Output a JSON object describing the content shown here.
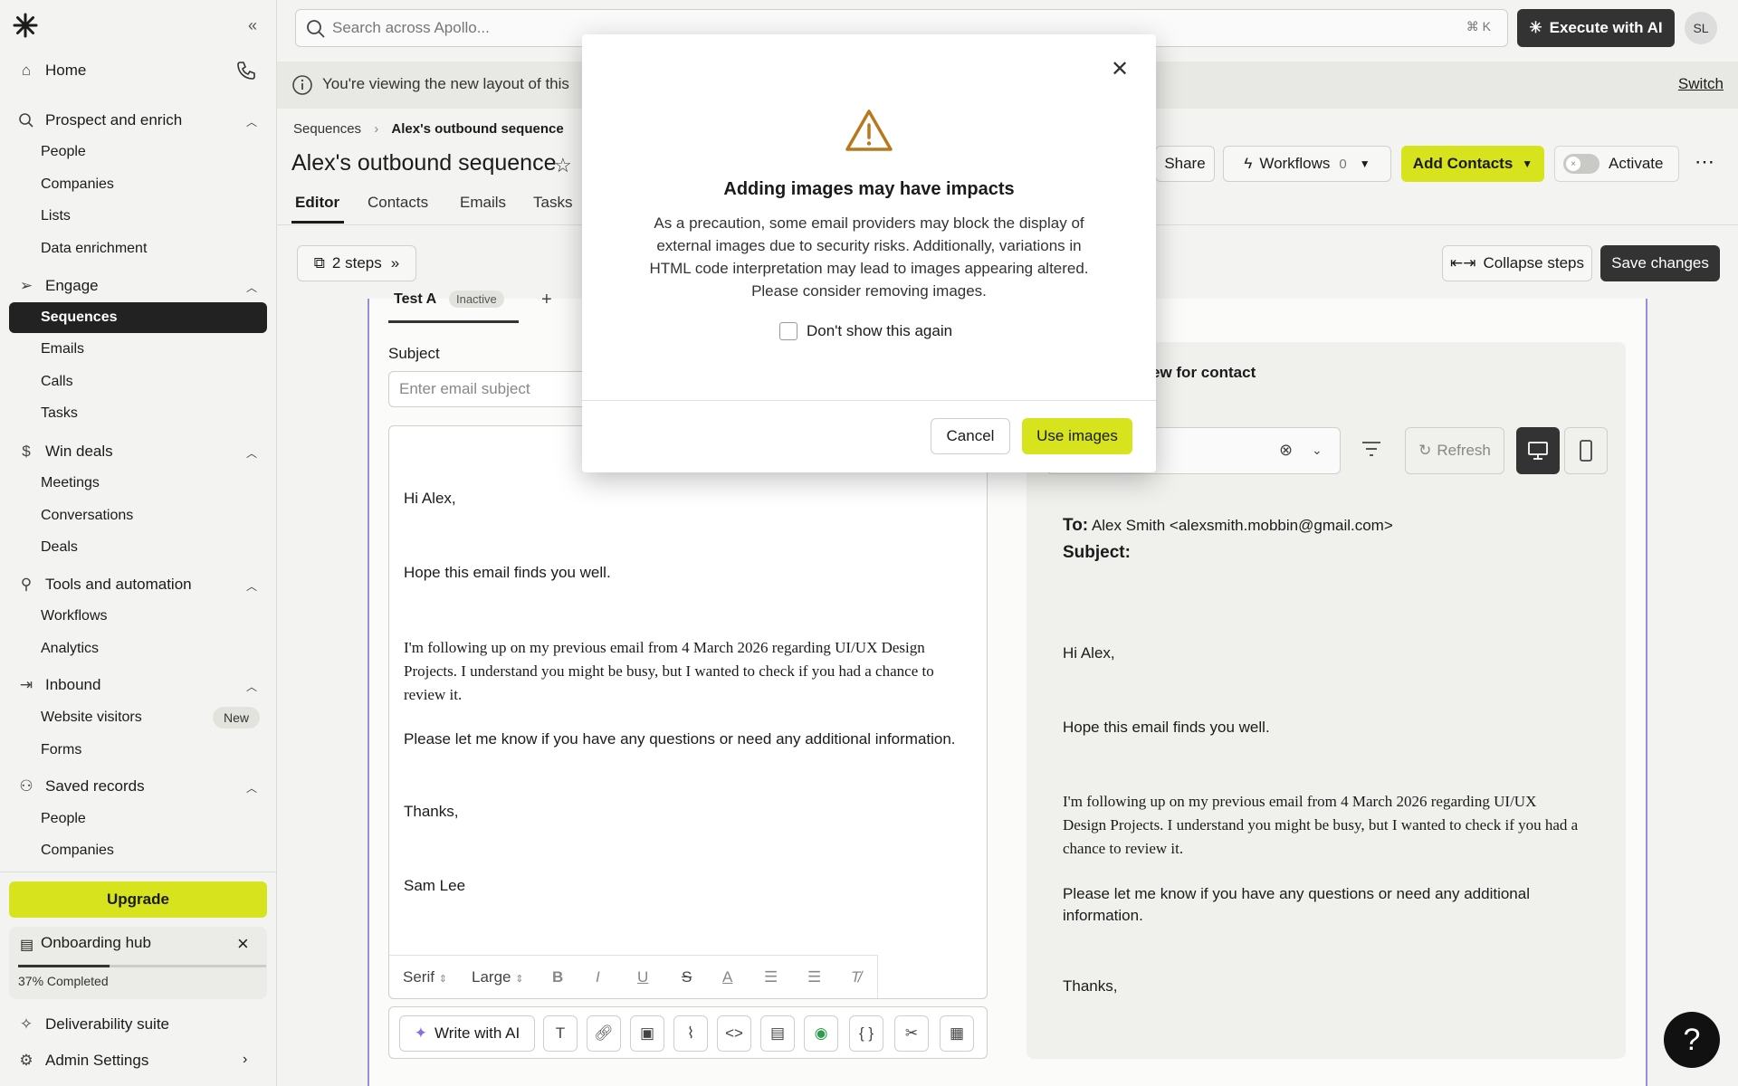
{
  "app": {
    "brand_color": "#d7e31d"
  },
  "sidebar": {
    "home": "Home",
    "prospect": "Prospect and enrich",
    "prospect_items": [
      "People",
      "Companies",
      "Lists",
      "Data enrichment"
    ],
    "engage": "Engage",
    "engage_items": [
      "Sequences",
      "Emails",
      "Calls",
      "Tasks"
    ],
    "win": "Win deals",
    "win_items": [
      "Meetings",
      "Conversations",
      "Deals"
    ],
    "tools": "Tools and automation",
    "tools_items": [
      "Workflows",
      "Analytics"
    ],
    "inbound": "Inbound",
    "inbound_items": [
      "Website visitors",
      "Forms"
    ],
    "new_badge": "New",
    "saved": "Saved records",
    "saved_items": [
      "People",
      "Companies"
    ],
    "upgrade": "Upgrade",
    "onboarding": {
      "title": "Onboarding hub",
      "progress": "37% Completed",
      "fraction": 0.37
    },
    "deliverability": "Deliverability suite",
    "admin": "Admin Settings"
  },
  "topbar": {
    "search_placeholder": "Search across Apollo...",
    "shortcut": "⌘ K",
    "execute": "Execute with AI",
    "avatar": "SL"
  },
  "banner": {
    "text": "You're viewing the new layout of this",
    "switch": "Switch"
  },
  "breadcrumb": {
    "root": "Sequences",
    "current": "Alex's outbound sequence"
  },
  "page": {
    "title": "Alex's outbound sequence"
  },
  "tabs": [
    "Editor",
    "Contacts",
    "Emails",
    "Tasks"
  ],
  "header_actions": {
    "share": "Share",
    "workflows": "Workflows",
    "workflows_count": "0",
    "add_contacts": "Add Contacts",
    "activate": "Activate"
  },
  "steps": {
    "label": "2 steps",
    "collapse": "Collapse steps",
    "save": "Save changes"
  },
  "editor": {
    "test_tab": "Test A",
    "test_badge": "Inactive",
    "subject_label": "Subject",
    "subject_placeholder": "Enter email subject",
    "greeting": "Hi Alex,",
    "line1": "Hope this email finds you well.",
    "line2": "I'm following up on my previous email from 4 March 2026 regarding UI/UX Design Projects. I understand you might be busy, but I wanted to check if you had a chance to review it.",
    "line3": "Please let me know if you have any questions or need any additional information.",
    "thanks": "Thanks,",
    "signature": "Sam Lee",
    "font": "Serif",
    "size": "Large",
    "write_ai": "Write with AI"
  },
  "preview": {
    "title": "ew for contact",
    "refresh": "Refresh",
    "to_label": "To:",
    "to_value": "Alex Smith <alexsmith.mobbin@gmail.com>",
    "subject_label": "Subject:"
  },
  "modal": {
    "title": "Adding images may have impacts",
    "body": "As a precaution, some email providers may block the display of external images due to security risks. Additionally, variations in HTML code interpretation may lead to images appearing altered. Please consider removing images.",
    "checkbox": "Don't show this again",
    "cancel": "Cancel",
    "confirm": "Use images"
  },
  "help": "?"
}
